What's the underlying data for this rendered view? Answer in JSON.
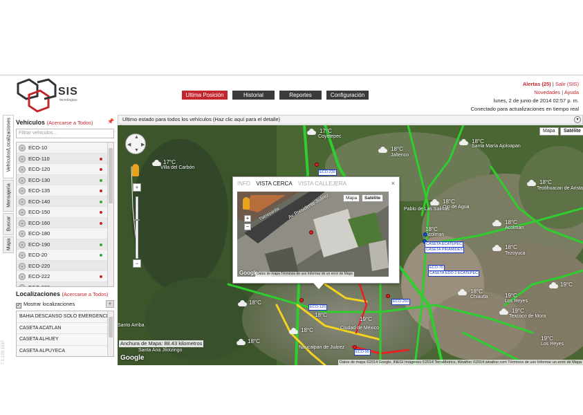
{
  "header": {
    "logo_text": "SIS",
    "logo_sub": "tecnologías",
    "nav": [
      "Ultima Posición",
      "Historial",
      "Reportes",
      "Configuración"
    ],
    "alerts": "Alertas (25)",
    "exit": "Salir (SIS)",
    "news": "Novedades",
    "help": "Ayuda",
    "date": "lunes, 2 de junio de 2014 02:57 p. m.",
    "status": "Conectado para actualizaciones en tiempo real"
  },
  "side_tabs": [
    "Vehículos/Localizaciones",
    "Mensajería",
    "Buscar",
    "Mapa"
  ],
  "version": "7.1.100.1537",
  "vehicles": {
    "title": "Vehículos",
    "zoom_link": "(Acercarse a Todos)",
    "filter_placeholder": "Filtrar vehículos...",
    "items": [
      {
        "name": "ECO-10",
        "status": ""
      },
      {
        "name": "ECO-110",
        "status": "#c0272d"
      },
      {
        "name": "ECO-120",
        "status": "#c0272d"
      },
      {
        "name": "ECO-130",
        "status": "#3aa53a"
      },
      {
        "name": "ECO-135",
        "status": "#c0272d"
      },
      {
        "name": "ECO-140",
        "status": "#3aa53a"
      },
      {
        "name": "ECO-150",
        "status": "#c0272d"
      },
      {
        "name": "ECO-160",
        "status": "#c0272d"
      },
      {
        "name": "ECO-180",
        "status": ""
      },
      {
        "name": "ECO-190",
        "status": "#3aa53a"
      },
      {
        "name": "ECO-20",
        "status": "#3aa53a"
      },
      {
        "name": "ECO-220",
        "status": ""
      },
      {
        "name": "ECO-222",
        "status": "#c0272d"
      },
      {
        "name": "ECO-270",
        "status": "#c0272d"
      }
    ]
  },
  "locations": {
    "title": "Localizaciones",
    "zoom_link": "(Acercarse a Todos)",
    "show_label": "Mostrar localizaciones",
    "items": [
      "BAHIA DESCANSO SOLO EMERGENCI",
      "CASETA ACATLAN",
      "CASETA ALHUEY",
      "CASETA ALPUYECA"
    ]
  },
  "map": {
    "bar_text": "Ultimo estado para todos los vehículos (Haz clic aquí para el detalle)",
    "type_map": "Mapa",
    "type_sat": "Satélite",
    "scale": "Anchura de Mapa: 88.43 kilometros",
    "google": "Google",
    "attribution": "Datos de mapa ©2014 Google, INEGI Imágenes ©2014 TerraMetrics, Weather ©2014 weather.com   Términos de uso   Informar un error de Mapa",
    "places": [
      {
        "name": "Villa del Carbón"
      },
      {
        "name": "Coyotepec"
      },
      {
        "name": "Jaltenco"
      },
      {
        "name": "Santa María Ajoloapan"
      },
      {
        "name": "Pablo de Las Salinas"
      },
      {
        "name": "Ojo de Agua"
      },
      {
        "name": "Teotihuacan de Arista"
      },
      {
        "name": "Tezoyuca"
      },
      {
        "name": "Chiautla"
      },
      {
        "name": "Los Reyes"
      },
      {
        "name": "Texcoco de Mora"
      },
      {
        "name": "Ciudad de México"
      },
      {
        "name": "Los Reyes"
      },
      {
        "name": "Santa Ana Jilotzingo"
      },
      {
        "name": "Ecatepec"
      },
      {
        "name": "Acolman"
      },
      {
        "name": "Acolman"
      },
      {
        "name": "Santo Arriba"
      },
      {
        "name": "Naucalpan de Juárez"
      }
    ],
    "temps": [
      "17°C",
      "17°C",
      "18°C",
      "18°C",
      "18°C",
      "18°C",
      "18°C",
      "18°C",
      "18°C",
      "19°C",
      "18°C",
      "19°C",
      "19°C",
      "19°C",
      "18°C",
      "18°C",
      "19°C",
      "18°C",
      "18°C"
    ],
    "labels": [
      "ECO-230",
      "ECO-120",
      "ECO-70",
      "CASETA EDO 2 ECATEPEC",
      "CASETA ECATEPEC",
      "CASETA PIRAMIDES",
      "ECO-260",
      "ECO-90"
    ]
  },
  "popup": {
    "tabs": [
      "INFO",
      "VISTA CERCA",
      "VISTA CALLEJERA"
    ],
    "active_tab": 1,
    "close": "×",
    "street": "Av Presidente Juárez",
    "street2": "Tlalnepantla",
    "type_map": "Mapa",
    "type_sat": "Satélite",
    "google": "Google",
    "attribution": "Datos de mapa   Términos de uso   Informar de un error de Maps"
  }
}
